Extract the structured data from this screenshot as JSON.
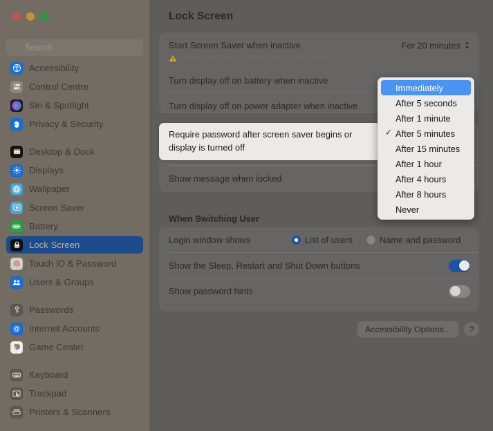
{
  "window": {
    "traffic_lights": [
      "close",
      "minimize",
      "zoom"
    ]
  },
  "sidebar": {
    "search": {
      "placeholder": "Search",
      "value": ""
    },
    "groups": [
      {
        "items": [
          {
            "label": "Accessibility",
            "icon": "accessibility-icon",
            "selected": false
          },
          {
            "label": "Control Centre",
            "icon": "control-centre-icon",
            "selected": false
          },
          {
            "label": "Siri & Spotlight",
            "icon": "siri-icon",
            "selected": false
          },
          {
            "label": "Privacy & Security",
            "icon": "privacy-security-icon",
            "selected": false
          }
        ]
      },
      {
        "items": [
          {
            "label": "Desktop & Dock",
            "icon": "desktop-dock-icon",
            "selected": false
          },
          {
            "label": "Displays",
            "icon": "displays-icon",
            "selected": false
          },
          {
            "label": "Wallpaper",
            "icon": "wallpaper-icon",
            "selected": false
          },
          {
            "label": "Screen Saver",
            "icon": "screen-saver-icon",
            "selected": false
          },
          {
            "label": "Battery",
            "icon": "battery-icon",
            "selected": false
          },
          {
            "label": "Lock Screen",
            "icon": "lock-screen-icon",
            "selected": true
          },
          {
            "label": "Touch ID & Password",
            "icon": "touch-id-icon",
            "selected": false
          },
          {
            "label": "Users & Groups",
            "icon": "users-groups-icon",
            "selected": false
          }
        ]
      },
      {
        "items": [
          {
            "label": "Passwords",
            "icon": "passwords-icon",
            "selected": false
          },
          {
            "label": "Internet Accounts",
            "icon": "internet-accounts-icon",
            "selected": false
          },
          {
            "label": "Game Center",
            "icon": "game-center-icon",
            "selected": false
          }
        ]
      },
      {
        "items": [
          {
            "label": "Keyboard",
            "icon": "keyboard-icon",
            "selected": false
          },
          {
            "label": "Trackpad",
            "icon": "trackpad-icon",
            "selected": false
          },
          {
            "label": "Printers & Scanners",
            "icon": "printers-scanners-icon",
            "selected": false
          }
        ]
      }
    ]
  },
  "main": {
    "title": "Lock Screen",
    "rows": {
      "screen_saver": {
        "label": "Start Screen Saver when inactive",
        "value": "For 20 minutes",
        "warning": "Display will sleep before screen saver starts."
      },
      "display_off_battery": {
        "label": "Turn display off on battery when inactive"
      },
      "display_off_power": {
        "label": "Turn display off on power adapter when inactive"
      },
      "require_password": {
        "label": "Require password after screen saver begins or display is turned off"
      },
      "show_message": {
        "label": "Show message when locked"
      }
    },
    "switching_user": {
      "heading": "When Switching User",
      "login_window": {
        "label": "Login window shows",
        "options": [
          {
            "label": "List of users",
            "selected": true
          },
          {
            "label": "Name and password",
            "selected": false
          }
        ]
      },
      "sleep_restart_shutdown": {
        "label": "Show the Sleep, Restart and Shut Down buttons",
        "on": true
      },
      "password_hints": {
        "label": "Show password hints",
        "on": false
      }
    },
    "footer": {
      "accessibility_button": "Accessibility Options...",
      "help_button": "?"
    }
  },
  "dropdown": {
    "items": [
      {
        "label": "Immediately",
        "highlighted": true,
        "checked": false
      },
      {
        "label": "After 5 seconds",
        "highlighted": false,
        "checked": false
      },
      {
        "label": "After 1 minute",
        "highlighted": false,
        "checked": false
      },
      {
        "label": "After 5 minutes",
        "highlighted": false,
        "checked": true
      },
      {
        "label": "After 15 minutes",
        "highlighted": false,
        "checked": false
      },
      {
        "label": "After 1 hour",
        "highlighted": false,
        "checked": false
      },
      {
        "label": "After 4 hours",
        "highlighted": false,
        "checked": false
      },
      {
        "label": "After 8 hours",
        "highlighted": false,
        "checked": false
      },
      {
        "label": "Never",
        "highlighted": false,
        "checked": false
      }
    ],
    "check_glyph": "✓"
  },
  "colors": {
    "accent_blue": "#1d56a8",
    "menu_highlight": "#4a93f0",
    "sidebar_selected": "#1d4a8a",
    "warning_yellow": "#d4a82a"
  }
}
